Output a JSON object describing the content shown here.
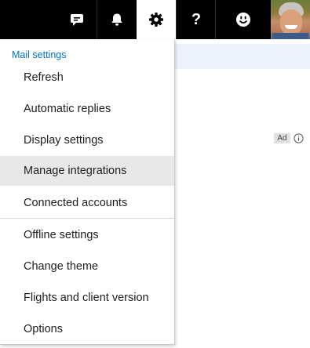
{
  "topbar": {
    "icons": [
      "chat-icon",
      "bell-icon",
      "gear-icon",
      "help-icon",
      "smiley-icon"
    ],
    "help_glyph": "?",
    "accent": "#000000"
  },
  "background": {
    "ad_label": "Ad",
    "info_icon": "info-icon"
  },
  "menu": {
    "header": "Mail settings",
    "items": [
      "Refresh",
      "Automatic replies",
      "Display settings",
      "Manage integrations",
      "Connected accounts",
      "Offline settings",
      "Change theme",
      "Flights and client version",
      "Options"
    ],
    "hovered_item": "Manage integrations",
    "header_color": "#0072c6"
  }
}
